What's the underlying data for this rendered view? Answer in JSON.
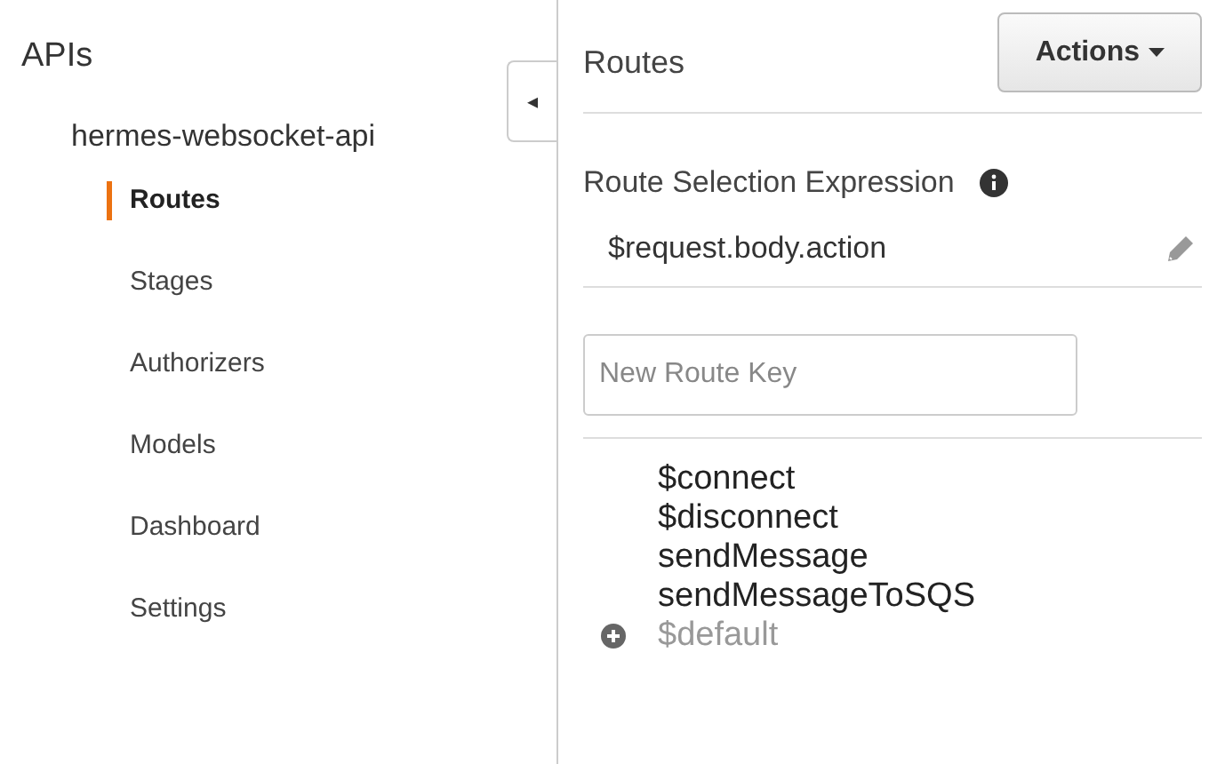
{
  "sidebar": {
    "title": "APIs",
    "api_name": "hermes-websocket-api",
    "items": [
      {
        "label": "Routes",
        "selected": true
      },
      {
        "label": "Stages",
        "selected": false
      },
      {
        "label": "Authorizers",
        "selected": false
      },
      {
        "label": "Models",
        "selected": false
      },
      {
        "label": "Dashboard",
        "selected": false
      },
      {
        "label": "Settings",
        "selected": false
      }
    ]
  },
  "collapse_toggle": {
    "icon": "◂"
  },
  "main": {
    "title": "Routes",
    "actions_button": "Actions",
    "route_selection": {
      "label": "Route Selection Expression",
      "value": "$request.body.action"
    },
    "new_route_field": {
      "placeholder": "New Route Key"
    },
    "routes": [
      {
        "label": "$connect",
        "kind": "route"
      },
      {
        "label": "$disconnect",
        "kind": "route"
      },
      {
        "label": "sendMessage",
        "kind": "route"
      },
      {
        "label": "sendMessageToSQS",
        "kind": "route"
      },
      {
        "label": "$default",
        "kind": "addable"
      }
    ]
  }
}
